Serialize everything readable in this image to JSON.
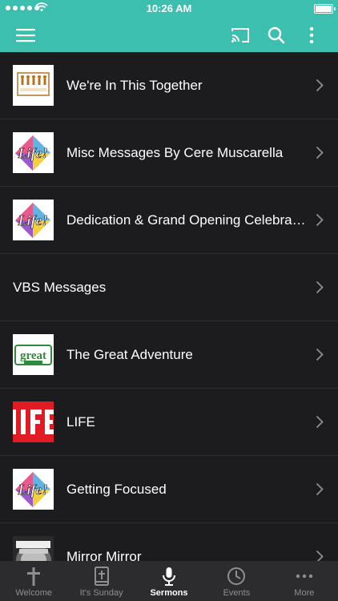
{
  "status_bar": {
    "time": "10:26 AM"
  },
  "nav": {
    "menu_icon": "hamburger-menu-icon",
    "cast_icon": "cast-icon",
    "search_icon": "search-icon",
    "more_icon": "vertical-dots-icon"
  },
  "series": [
    {
      "title": "We're In This Together",
      "thumb": "together-logo"
    },
    {
      "title": "Misc Messages By Cere Muscarella",
      "thumb": "life-logo"
    },
    {
      "title": "Dedication & Grand Opening Celebrat...",
      "thumb": "life-logo"
    },
    {
      "title": "VBS Messages",
      "thumb": ""
    },
    {
      "title": "The Great Adventure",
      "thumb": "great-adventure-logo"
    },
    {
      "title": "LIFE",
      "thumb": "life-red-logo"
    },
    {
      "title": "Getting Focused",
      "thumb": "life-logo"
    },
    {
      "title": "Mirror Mirror",
      "thumb": "mirror-logo"
    }
  ],
  "tabs": [
    {
      "label": "Welcome",
      "icon": "cross-icon"
    },
    {
      "label": "It's Sunday",
      "icon": "bible-icon"
    },
    {
      "label": "Sermons",
      "icon": "microphone-icon",
      "active": true
    },
    {
      "label": "Events",
      "icon": "clock-icon"
    },
    {
      "label": "More",
      "icon": "more-dots-icon"
    }
  ],
  "colors": {
    "accent": "#3dbfb0",
    "background": "#1c1c1e",
    "tabbar": "#2c2c2e"
  }
}
